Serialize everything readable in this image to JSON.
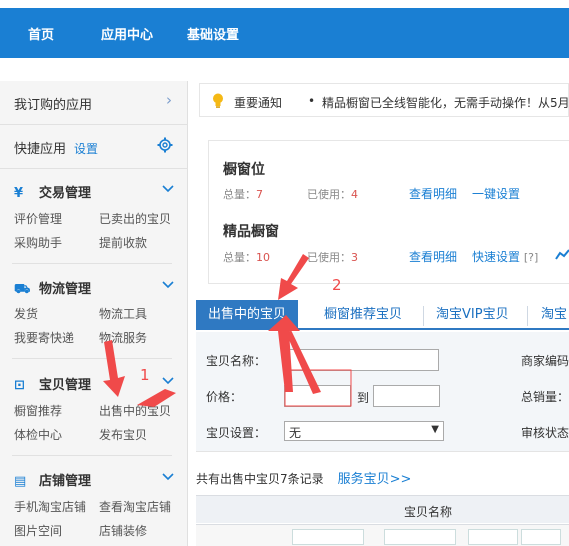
{
  "topnav": {
    "items": [
      "首页",
      "应用中心",
      "基础设置"
    ]
  },
  "sidebar": {
    "subscribed": "我订购的应用",
    "quick_apps": "快捷应用",
    "settings_link": "设置",
    "groups": [
      {
        "title": "交易管理",
        "icon": "¥",
        "links": [
          "评价管理",
          "已卖出的宝贝",
          "采购助手",
          "提前收款"
        ]
      },
      {
        "title": "物流管理",
        "icon": "⛟",
        "links": [
          "发货",
          "物流工具",
          "我要寄快递",
          "物流服务"
        ]
      },
      {
        "title": "宝贝管理",
        "icon": "⊡",
        "links": [
          "橱窗推荐",
          "出售中的宝贝",
          "体检中心",
          "发布宝贝"
        ]
      },
      {
        "title": "店铺管理",
        "icon": "▤",
        "links": [
          "手机淘宝店铺",
          "查看淘宝店铺",
          "图片空间",
          "店铺装修"
        ]
      }
    ]
  },
  "notice": {
    "label": "重要通知",
    "dot": "•",
    "text": "精品橱窗已全线智能化，无需手动操作！从5月"
  },
  "window_panel": {
    "showcase": {
      "title": "橱窗位",
      "total_label": "总量：",
      "total": "7",
      "used_label": "已使用：",
      "used": "4",
      "detail_link": "查看明细",
      "action_link": "一键设置"
    },
    "premium": {
      "title": "精品橱窗",
      "total_label": "总量：",
      "total": "10",
      "used_label": "已使用：",
      "used": "3",
      "detail_link": "查看明细",
      "action_link": "快速设置",
      "help": "[?]"
    }
  },
  "tabs": [
    "出售中的宝贝",
    "橱窗推荐宝贝",
    "淘宝VIP宝贝",
    "淘宝"
  ],
  "form": {
    "item_name_label": "宝贝名称：",
    "merchant_code_label": "商家编码",
    "price_label": "价格：",
    "price_to": "到",
    "sales_label": "总销量：",
    "setting_label": "宝贝设置：",
    "setting_value": "无",
    "review_label": "审核状态"
  },
  "records": {
    "text": "共有出售中宝贝7条记录",
    "service_link": "服务宝贝>>"
  },
  "table": {
    "header": "宝贝名称"
  },
  "annotations": {
    "one": "1",
    "two": "2",
    "color": "#f04a4a"
  },
  "colors": {
    "topbar": "#1a7fd3",
    "accent": "#2f79c2",
    "number": "#d9534f"
  }
}
